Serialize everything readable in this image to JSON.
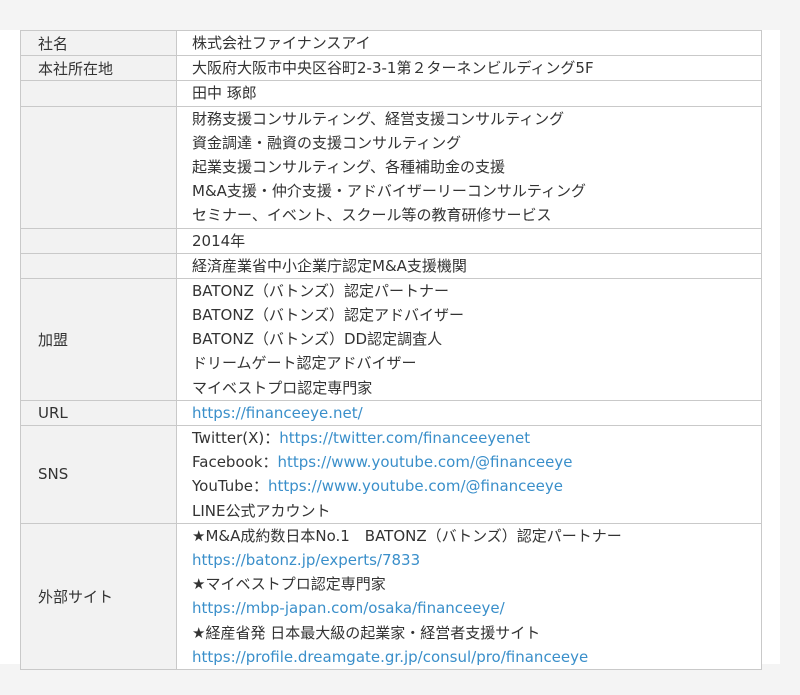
{
  "rows": [
    {
      "label": "社名",
      "lines": [
        "株式会社ファイナンスアイ"
      ]
    },
    {
      "label": "本社所在地",
      "lines": [
        "大阪府大阪市中央区谷町2-3-1第２ターネンビルディング5F"
      ]
    },
    {
      "label": "",
      "lines": [
        "田中 琢郎"
      ]
    },
    {
      "label": "",
      "lines": [
        "財務支援コンサルティング、経営支援コンサルティング",
        "資金調達・融資の支援コンサルティング",
        "起業支援コンサルティング、各種補助金の支援",
        "M&A支援・仲介支援・アドバイザーリーコンサルティング",
        "セミナー、イベント、スクール等の教育研修サービス"
      ]
    },
    {
      "label": "",
      "lines": [
        "2014年"
      ]
    },
    {
      "label": "",
      "lines": [
        "経済産業省中小企業庁認定M&A支援機関"
      ]
    },
    {
      "label": "加盟",
      "lines": [
        "BATONZ（バトンズ）認定パートナー",
        "BATONZ（バトンズ）認定アドバイザー",
        "BATONZ（バトンズ）DD認定調査人",
        "ドリームゲート認定アドバイザー",
        "マイベストプロ認定専門家"
      ]
    },
    {
      "label": "URL",
      "url": "https://financeeye.net/"
    },
    {
      "label": "SNS",
      "twitter_prefix": "Twitter(X)：",
      "twitter_url": "https://twitter.com/financeeyenet",
      "facebook_prefix": "Facebook：",
      "facebook_url": "https://www.youtube.com/@financeeye",
      "youtube_prefix": "YouTube：",
      "youtube_url": "https://www.youtube.com/@financeeye",
      "line_text": "LINE公式アカウント"
    },
    {
      "label": "外部サイト",
      "site1_title": "★M&A成約数日本No.1　BATONZ（バトンズ）認定パートナー",
      "site1_url": "https://batonz.jp/experts/7833",
      "site2_title": "★マイベストプロ認定専門家",
      "site2_url": "https://mbp-japan.com/osaka/financeeye/",
      "site3_title": "★経産省発 日本最大級の起業家・経営者支援サイト",
      "site3_url": "https://profile.dreamgate.gr.jp/consul/pro/financeeye"
    }
  ],
  "colors": {
    "link": "#3a8fca",
    "text": "#333333",
    "label_bg": "#f2f2f2",
    "border": "#c9c9c9"
  }
}
